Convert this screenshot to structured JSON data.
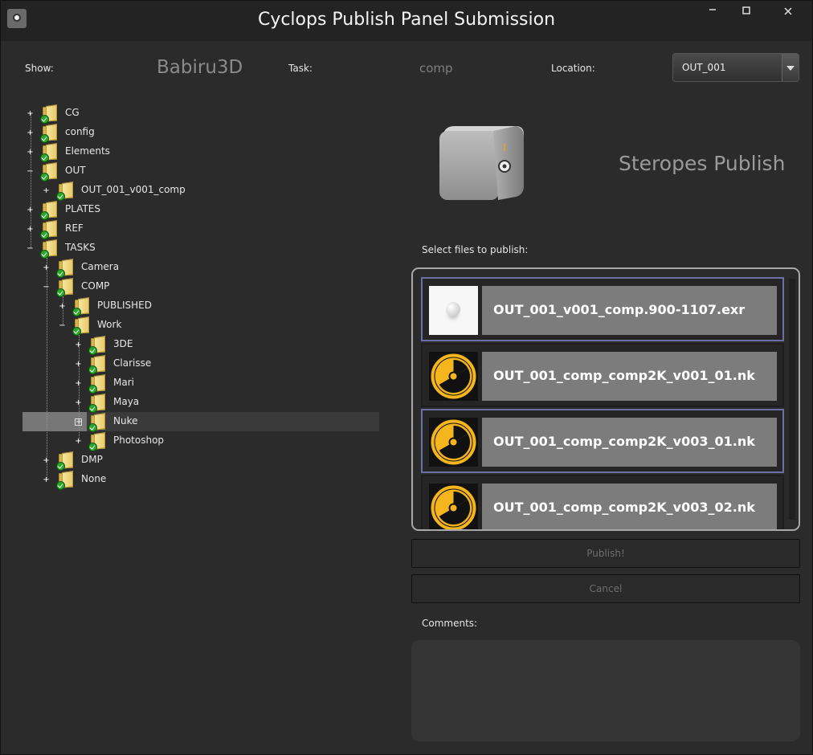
{
  "window": {
    "title": "Cyclops Publish Panel Submission"
  },
  "header": {
    "show_label": "Show:",
    "show_value": "Babiru3D",
    "task_label": "Task:",
    "task_value": "comp",
    "location_label": "Location:",
    "location_value": "OUT_001"
  },
  "tree": {
    "CG": "CG",
    "config": "config",
    "Elements": "Elements",
    "OUT": "OUT",
    "OUT_child": "OUT_001_v001_comp",
    "PLATES": "PLATES",
    "REF": "REF",
    "TASKS": "TASKS",
    "Camera": "Camera",
    "COMP": "COMP",
    "PUBLISHED": "PUBLISHED",
    "Work": "Work",
    "3DE": "3DE",
    "Clarisse": "Clarisse",
    "Mari": "Mari",
    "Maya": "Maya",
    "Nuke": "Nuke",
    "Photoshop": "Photoshop",
    "DMP": "DMP",
    "None": "None"
  },
  "publish_panel": {
    "title": "Steropes Publish",
    "select_label": "Select files to publish:",
    "files": [
      {
        "name": "OUT_001_v001_comp.900-1107.exr",
        "selected": true
      },
      {
        "name": "OUT_001_comp_comp2K_v001_01.nk",
        "selected": false
      },
      {
        "name": "OUT_001_comp_comp2K_v003_01.nk",
        "selected": true
      },
      {
        "name": "OUT_001_comp_comp2K_v003_02.nk",
        "selected": false
      }
    ],
    "publish_button": "Publish!",
    "cancel_button": "Cancel",
    "comments_label": "Comments:"
  },
  "colors": {
    "selection_border": "#6f6fa7",
    "accent_nuke": "#f5b51c"
  }
}
